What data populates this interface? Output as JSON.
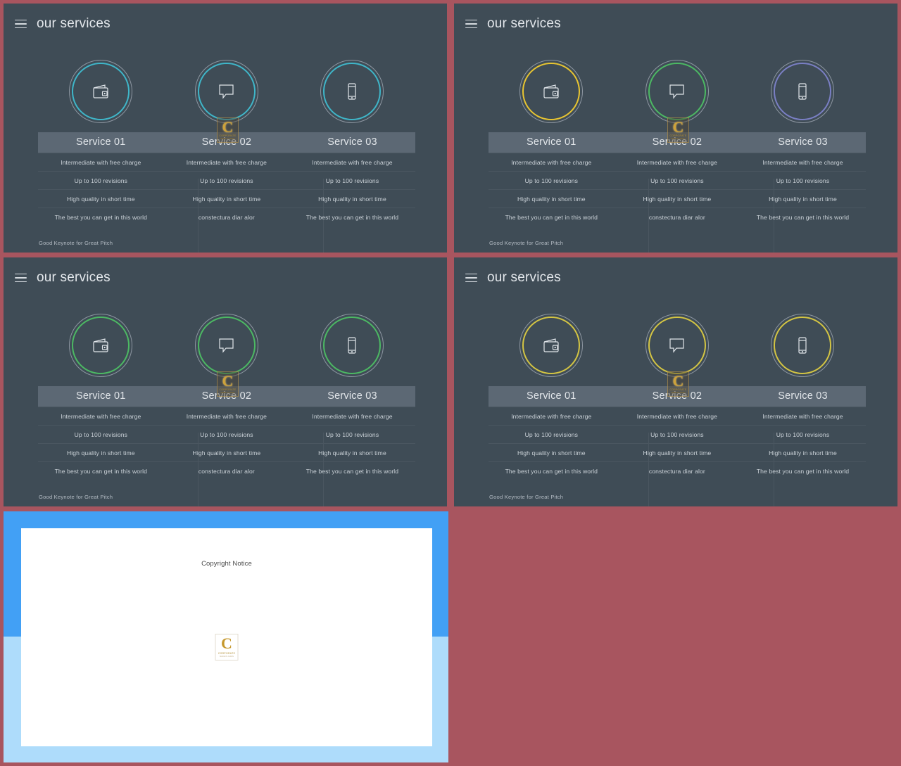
{
  "background_color": "#a8555f",
  "slide_bg": "#3f4c56",
  "header": {
    "menu_icon": "hamburger-icon",
    "title": "our services"
  },
  "footer": {
    "text": "Good Keynote for Great Pitch"
  },
  "icons": [
    {
      "name": "wallet-icon"
    },
    {
      "name": "speech-bubble-icon"
    },
    {
      "name": "smartphone-icon"
    }
  ],
  "table": {
    "titles": [
      "Service 01",
      "Service 02",
      "Service 03"
    ],
    "rows": [
      [
        "Intermediate with free charge",
        "Intermediate with free charge",
        "Intermediate with free charge"
      ],
      [
        "Up to 100 revisions",
        "Up to 100 revisions",
        "Up to 100 revisions"
      ],
      [
        "High quality in short time",
        "High quality in short time",
        "High quality in short time"
      ],
      [
        "The best you can get in this world",
        "constectura diar alor",
        "The best you can get in this world"
      ]
    ]
  },
  "watermark": {
    "letter": "C",
    "sub": "CORPORATE",
    "sub2": "MADE IN JAPAN"
  },
  "slides": [
    {
      "position": "top-left",
      "ring_colors": [
        "#3fb6c9",
        "#3fb6c9",
        "#3fb6c9"
      ]
    },
    {
      "position": "top-right",
      "ring_colors": [
        "#e8c531",
        "#4cb963",
        "#7a7fc4"
      ]
    },
    {
      "position": "bottom-left",
      "ring_colors": [
        "#4cb963",
        "#4cb963",
        "#4cb963"
      ]
    },
    {
      "position": "bottom-right",
      "ring_colors": [
        "#d4c543",
        "#d4c543",
        "#d4c543"
      ]
    }
  ],
  "copyright_slide": {
    "frame_color_top": "#42a0f5",
    "frame_color_bottom": "#aedcfb",
    "title": "Copyright Notice",
    "logo": {
      "letter": "C",
      "sub": "CORPORATE",
      "sub2": "MADE IN JAPAN"
    }
  }
}
